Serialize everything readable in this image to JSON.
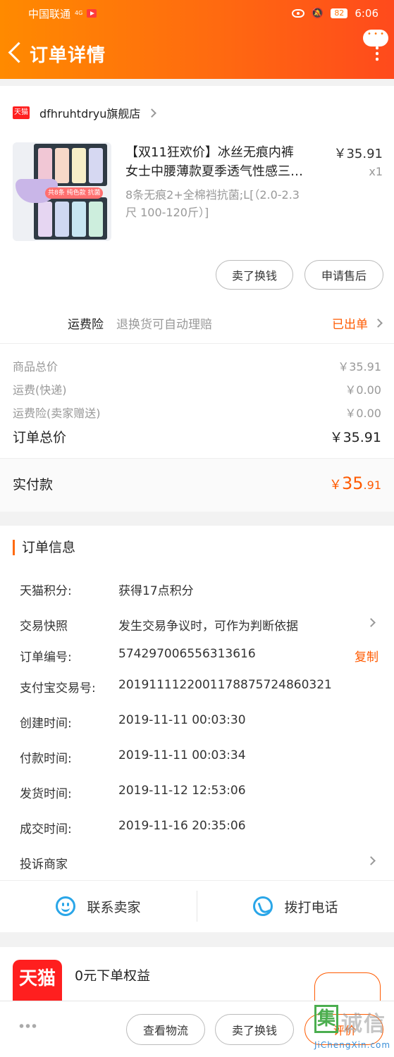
{
  "status": {
    "carrier": "中国联通",
    "network": "4G",
    "battery": "82",
    "time": "6:06"
  },
  "nav": {
    "title": "订单详情"
  },
  "shop": {
    "badge": "天猫",
    "name": "dfhruhtdryu旗舰店"
  },
  "product": {
    "title_line1": "【双11狂欢价】冰丝无痕内裤",
    "title_line2": "女士中腰薄款夏季透气性感三…",
    "price": "￥35.91",
    "qty": "x1",
    "sku_line1": "8条无痕2+全棉裆抗菌;L[（2.0-2.3",
    "sku_line2": "尺 100-120斤）]",
    "thumb_tag": "共8条 纯色款 抗菌"
  },
  "actions": {
    "sell": "卖了换钱",
    "after_sale": "申请售后"
  },
  "insurance": {
    "label": "运费险",
    "desc": "退换货可自动理赔",
    "status": "已出单"
  },
  "summary": {
    "goods_label": "商品总价",
    "goods_val": "￥35.91",
    "ship_label": "运费(快递)",
    "ship_val": "￥0.00",
    "ins_label": "运费险(卖家赠送)",
    "ins_val": "￥0.00",
    "total_label": "订单总价",
    "total_val": "￥35.91",
    "paid_label": "实付款",
    "paid_sym": "￥",
    "paid_int": "35",
    "paid_dec": ".91"
  },
  "info": {
    "title": "订单信息",
    "points_k": "天猫积分:",
    "points_v": "获得17点积分",
    "snapshot_k": "交易快照",
    "snapshot_v": "发生交易争议时，可作为判断依据",
    "order_k": "订单编号:",
    "order_v": "574297006556313616",
    "copy": "复制",
    "alipay_k": "支付宝交易号:",
    "alipay_v": "2019111122001178875724860321",
    "created_k": "创建时间:",
    "created_v": "2019-11-11 00:03:30",
    "paid_k": "付款时间:",
    "paid_v": "2019-11-11 00:03:34",
    "shipped_k": "发货时间:",
    "shipped_v": "2019-11-12 12:53:06",
    "done_k": "成交时间:",
    "done_v": "2019-11-16 20:35:06",
    "complain": "投诉商家"
  },
  "contact": {
    "seller": "联系卖家",
    "call": "拨打电话"
  },
  "promo": {
    "logo": "天猫",
    "text": "0元下单权益"
  },
  "bottom": {
    "logistics": "查看物流",
    "sell": "卖了换钱",
    "review": "评价"
  },
  "watermark": {
    "char": "集",
    "brand": "诚信",
    "url": "JiChengXin.com"
  }
}
